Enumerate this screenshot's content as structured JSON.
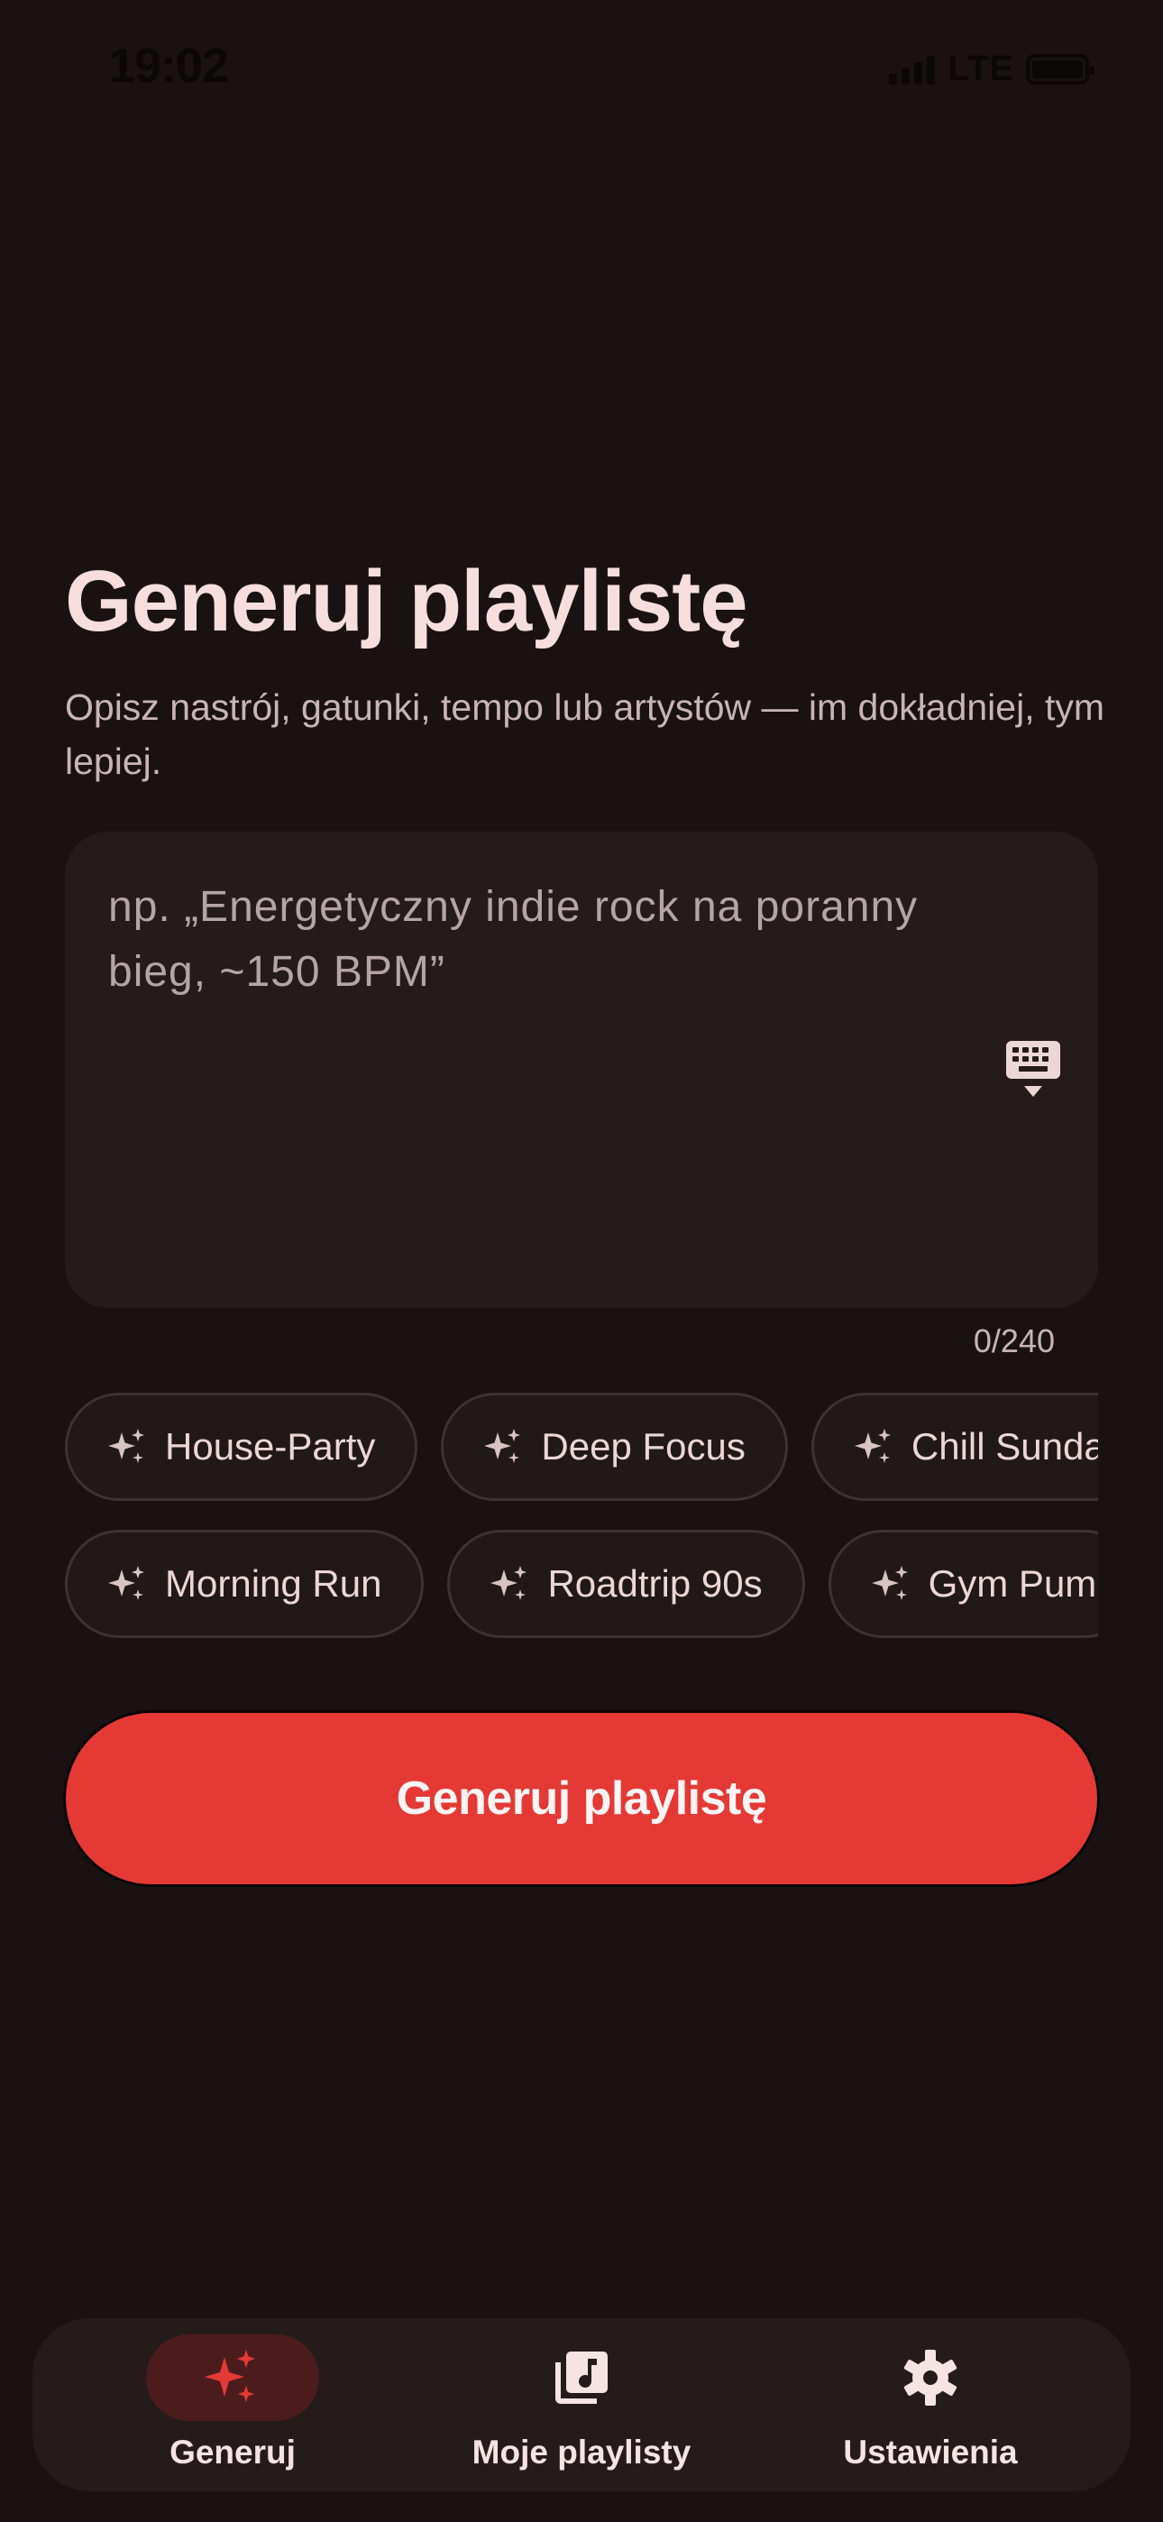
{
  "status_bar": {
    "time": "19:02",
    "network": "LTE"
  },
  "header": {
    "title": "Generuj playlistę",
    "subtitle": "Opisz nastrój, gatunki, tempo lub artystów — im dokładniej, tym lepiej."
  },
  "prompt": {
    "value": "",
    "placeholder": "np. „Energetyczny indie rock na poranny bieg, ~150 BPM”",
    "counter": "0/240",
    "keyboard_icon": "keyboard-hide-icon"
  },
  "chips": {
    "icon": "sparkle-icon",
    "row1": [
      "House-Party",
      "Deep Focus",
      "Chill Sunda"
    ],
    "row2": [
      "Morning Run",
      "Roadtrip 90s",
      "Gym Pum"
    ]
  },
  "generate_button": {
    "label": "Generuj playlistę"
  },
  "nav": {
    "items": [
      {
        "label": "Generuj",
        "icon": "sparkle-icon",
        "active": true
      },
      {
        "label": "Moje playlisty",
        "icon": "music-library-icon",
        "active": false
      },
      {
        "label": "Ustawienia",
        "icon": "gear-icon",
        "active": false
      }
    ]
  },
  "colors": {
    "background": "#1a1212",
    "accent": "#e53935",
    "surface": "#251b1b",
    "active_nav_bg": "#4c1c1c"
  }
}
